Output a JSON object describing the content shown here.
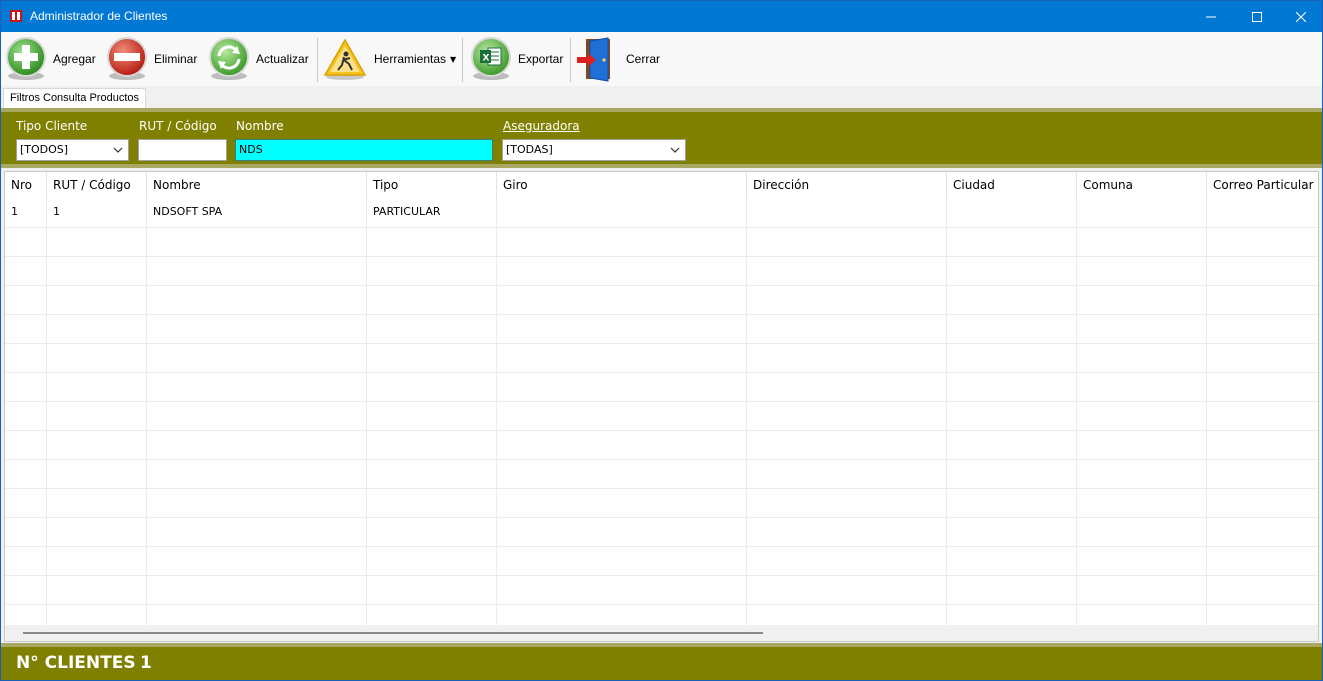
{
  "window": {
    "title": "Administrador de Clientes",
    "accent_color": "#0078d4"
  },
  "toolbar": {
    "add_label": "Agregar",
    "delete_label": "Eliminar",
    "refresh_label": "Actualizar",
    "tools_label": "Herramientas",
    "export_label": "Exportar",
    "close_label": "Cerrar"
  },
  "tabs": {
    "filters_tab": "Filtros Consulta Productos"
  },
  "filters": {
    "panel_color": "#808000",
    "tipo_cliente": {
      "label": "Tipo Cliente",
      "value": "[TODOS]"
    },
    "rut_codigo": {
      "label": "RUT / Código",
      "value": ""
    },
    "nombre": {
      "label": "Nombre",
      "value": "NDS"
    },
    "aseguradora": {
      "label": "Aseguradora",
      "value": "[TODAS]"
    }
  },
  "grid": {
    "columns": [
      "Nro",
      "RUT / Código",
      "Nombre",
      "Tipo",
      "Giro",
      "Dirección",
      "Ciudad",
      "Comuna",
      "Correo Particular"
    ],
    "rows": [
      [
        "1",
        "1",
        "NDSOFT SPA",
        "PARTICULAR",
        "",
        "",
        "",
        "",
        ""
      ]
    ]
  },
  "footer": {
    "label": "N° CLIENTES",
    "count": "1"
  }
}
